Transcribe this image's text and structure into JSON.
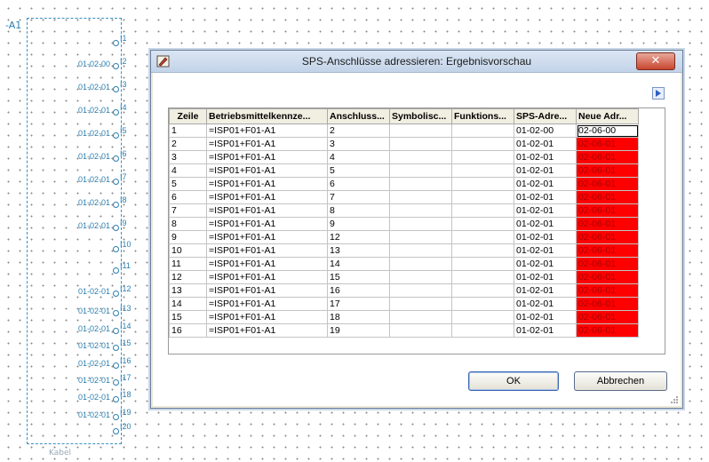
{
  "background": {
    "plc_label": "-A1",
    "kabel_label": "Kabel",
    "pins": [
      {
        "pin": "I1",
        "addr": ""
      },
      {
        "pin": "I2",
        "addr": "01-02-00"
      },
      {
        "pin": "I3",
        "addr": "01-02-01"
      },
      {
        "pin": "I4",
        "addr": "01-02-01"
      },
      {
        "pin": "I5",
        "addr": "01-02-01"
      },
      {
        "pin": "I6",
        "addr": "01-02-01"
      },
      {
        "pin": "I7",
        "addr": "01-02-01"
      },
      {
        "pin": "I8",
        "addr": "01-02-01"
      },
      {
        "pin": "I9",
        "addr": "01-02-01"
      },
      {
        "pin": "I10",
        "addr": ""
      },
      {
        "pin": "I11",
        "addr": ""
      },
      {
        "pin": "I12",
        "addr": "01-02-01"
      },
      {
        "pin": "I13",
        "addr": "01-02-01"
      },
      {
        "pin": "I14",
        "addr": "01-02-01"
      },
      {
        "pin": "I15",
        "addr": "01-02-01"
      },
      {
        "pin": "I16",
        "addr": "01-02-01"
      },
      {
        "pin": "I17",
        "addr": "01-02-01"
      },
      {
        "pin": "I18",
        "addr": "01-02-01"
      },
      {
        "pin": "I19",
        "addr": "01-02-01"
      },
      {
        "pin": "I20",
        "addr": ""
      }
    ]
  },
  "dialog": {
    "title": "SPS-Anschlüsse adressieren: Ergebnisvorschau",
    "close_label": "✕",
    "ok_label": "OK",
    "cancel_label": "Abbrechen",
    "columns": [
      "Zeile",
      "Betriebsmittelkennze...",
      "Anschluss...",
      "Symbolisc...",
      "Funktions...",
      "SPS-Adre...",
      "Neue Adr..."
    ],
    "rows": [
      [
        "1",
        "=ISP01+F01-A1",
        "2",
        "",
        "",
        "01-02-00",
        "02-06-00"
      ],
      [
        "2",
        "=ISP01+F01-A1",
        "3",
        "",
        "",
        "01-02-01",
        "02-06-01"
      ],
      [
        "3",
        "=ISP01+F01-A1",
        "4",
        "",
        "",
        "01-02-01",
        "02-06-01"
      ],
      [
        "4",
        "=ISP01+F01-A1",
        "5",
        "",
        "",
        "01-02-01",
        "02-06-01"
      ],
      [
        "5",
        "=ISP01+F01-A1",
        "6",
        "",
        "",
        "01-02-01",
        "02-06-01"
      ],
      [
        "6",
        "=ISP01+F01-A1",
        "7",
        "",
        "",
        "01-02-01",
        "02-06-01"
      ],
      [
        "7",
        "=ISP01+F01-A1",
        "8",
        "",
        "",
        "01-02-01",
        "02-06-01"
      ],
      [
        "8",
        "=ISP01+F01-A1",
        "9",
        "",
        "",
        "01-02-01",
        "02-06-01"
      ],
      [
        "9",
        "=ISP01+F01-A1",
        "12",
        "",
        "",
        "01-02-01",
        "02-06-01"
      ],
      [
        "10",
        "=ISP01+F01-A1",
        "13",
        "",
        "",
        "01-02-01",
        "02-06-01"
      ],
      [
        "11",
        "=ISP01+F01-A1",
        "14",
        "",
        "",
        "01-02-01",
        "02-06-01"
      ],
      [
        "12",
        "=ISP01+F01-A1",
        "15",
        "",
        "",
        "01-02-01",
        "02-06-01"
      ],
      [
        "13",
        "=ISP01+F01-A1",
        "16",
        "",
        "",
        "01-02-01",
        "02-06-01"
      ],
      [
        "14",
        "=ISP01+F01-A1",
        "17",
        "",
        "",
        "01-02-01",
        "02-06-01"
      ],
      [
        "15",
        "=ISP01+F01-A1",
        "18",
        "",
        "",
        "01-02-01",
        "02-06-01"
      ],
      [
        "16",
        "=ISP01+F01-A1",
        "19",
        "",
        "",
        "01-02-01",
        "02-06-01"
      ]
    ],
    "highlight_color": "#ff0000"
  }
}
